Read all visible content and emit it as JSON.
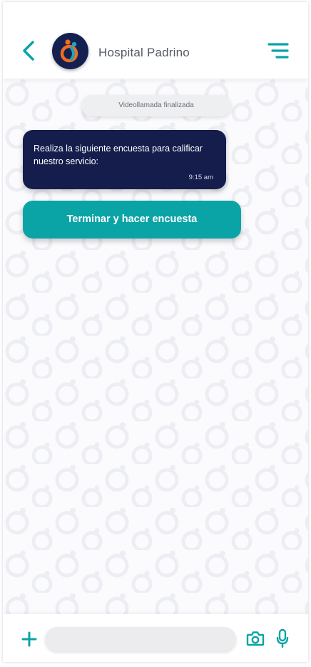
{
  "header": {
    "title": "Hospital Padrino",
    "back_icon": "chevron-left-icon",
    "menu_icon": "menu-lines-icon",
    "avatar_icon": "hospital-logo"
  },
  "chat": {
    "system_message": "Videollamada finalizada",
    "messages": [
      {
        "text": "Realiza la siguiente encuesta para calificar nuestro servicio:",
        "time": "9:15 am"
      }
    ],
    "action_button": "Terminar y hacer encuesta"
  },
  "composer": {
    "placeholder": "",
    "plus_icon": "plus-icon",
    "camera_icon": "camera-icon",
    "mic_icon": "microphone-icon"
  },
  "colors": {
    "accent": "#0aa3a6",
    "bubble": "#141d4c",
    "avatar_bg": "#142050",
    "logo_orange": "#f26b21"
  }
}
